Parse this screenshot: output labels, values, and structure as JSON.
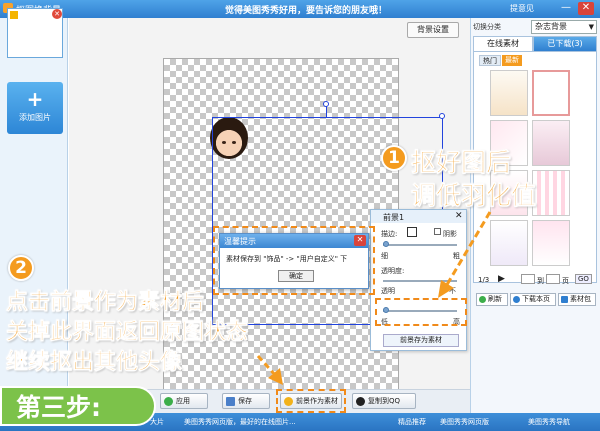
{
  "titlebar": {
    "app_title": "抠图换背景",
    "center_text": "觉得美图秀秀好用，要告诉您的朋友哦！",
    "feedback": "提意见",
    "minimize": "—",
    "close": "✕"
  },
  "left": {
    "add_label": "添加图片",
    "add_plus": "+",
    "thumb_close": "✕"
  },
  "canvas": {
    "bg_settings": "背景设置",
    "collapse": "▼"
  },
  "foreground_panel": {
    "title": "前景1",
    "close": "✕",
    "border_label": "描边:",
    "shadow_label": "阴影",
    "thin": "细",
    "thick": "粗",
    "transparency": "透明度:",
    "transparent": "透明",
    "opaque": "不",
    "low": "低",
    "high": "高",
    "save_material": "前景存为素材"
  },
  "dialog": {
    "title": "温馨提示",
    "close": "✕",
    "message": "素材保存到 \"饰品\" -> \"用户自定义\" 下",
    "ok": "确定"
  },
  "buttons": {
    "apply": "应用",
    "save": "保存",
    "as_material": "前景作为素材",
    "copy_to_qq": "复制到QQ"
  },
  "right": {
    "switch_label": "切换分类",
    "category": "杂志背景",
    "tab_online": "在线素材",
    "tab_downloaded": "已下载(3)",
    "subtab_hot": "热门",
    "subtab_new": "最新",
    "page_info": "1/3",
    "page_to": "到",
    "page_suffix": "页",
    "go": "GO",
    "refresh": "刷新",
    "download_page": "下载本页",
    "material_pkg": "素材包"
  },
  "statusbar": {
    "item1": "大片",
    "item2": "美图秀秀网页版，最好的在线图片...",
    "item3": "精品推荐",
    "item4": "美图秀秀网页版",
    "item5": "美图秀秀导航"
  },
  "annotations": {
    "step1_num": "1",
    "step1_line1": "抠好图后",
    "step1_line2": "调低羽化值",
    "step2_num": "2",
    "step2_line1": "点击前景作为素材后",
    "step2_line2": "关掉此界面返回原图状态",
    "step2_line3": "继续抠出其他头像",
    "step3": "第三步:"
  },
  "colors": {
    "accent_orange": "#f49b1f",
    "step_green": "#7cc24a",
    "title_blue": "#2f7fd0",
    "selection_blue": "#2244dd"
  }
}
